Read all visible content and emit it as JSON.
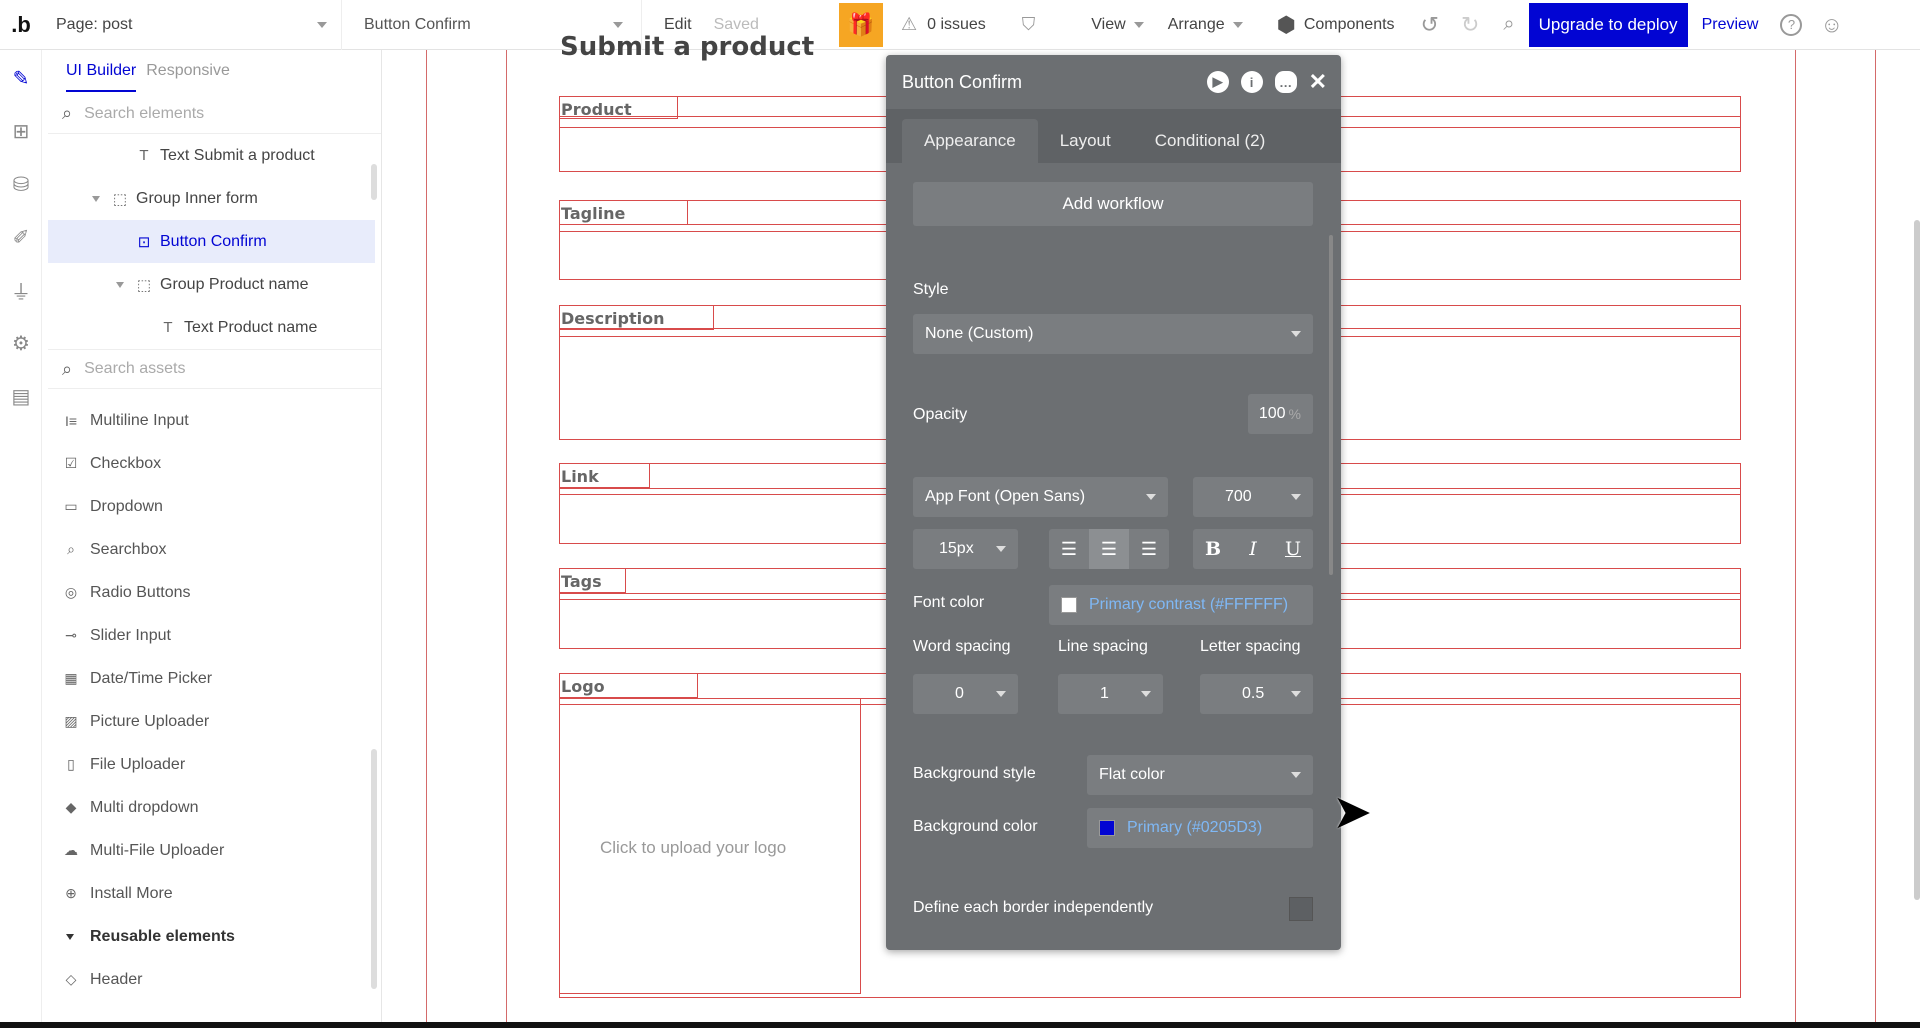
{
  "topbar": {
    "logo": ".b",
    "page_label": "Page: post",
    "element_label": "Button Confirm",
    "edit": "Edit",
    "saved": "Saved",
    "issues": "0 issues",
    "view": "View",
    "arrange": "Arrange",
    "components": "Components",
    "deploy": "Upgrade to deploy",
    "preview": "Preview",
    "help": "?"
  },
  "leftpanel": {
    "tab_ui": "UI Builder",
    "tab_responsive": "Responsive",
    "search_elements_placeholder": "Search elements",
    "tree": [
      {
        "label": "Text Submit a product"
      },
      {
        "label": "Group Inner form"
      },
      {
        "label": "Button Confirm"
      },
      {
        "label": "Group Product name"
      },
      {
        "label": "Text Product name"
      }
    ],
    "search_assets_placeholder": "Search assets",
    "assets": [
      {
        "label": "Multiline Input"
      },
      {
        "label": "Checkbox"
      },
      {
        "label": "Dropdown"
      },
      {
        "label": "Searchbox"
      },
      {
        "label": "Radio Buttons"
      },
      {
        "label": "Slider Input"
      },
      {
        "label": "Date/Time Picker"
      },
      {
        "label": "Picture Uploader"
      },
      {
        "label": "File Uploader"
      },
      {
        "label": "Multi dropdown"
      },
      {
        "label": "Multi-File Uploader"
      },
      {
        "label": "Install More"
      }
    ],
    "reusable_heading": "Reusable elements",
    "reusable_items": [
      {
        "label": "Header"
      }
    ]
  },
  "canvas": {
    "heading": "Submit a product",
    "fields": {
      "product": "Product",
      "tagline": "Tagline",
      "description": "Description",
      "link": "Link",
      "tags": "Tags",
      "logo": "Logo"
    },
    "upload_hint": "Click to upload your logo"
  },
  "editor": {
    "title": "Button Confirm",
    "tabs": {
      "appearance": "Appearance",
      "layout": "Layout",
      "conditional": "Conditional (2)"
    },
    "add_workflow": "Add workflow",
    "style_label": "Style",
    "style_value": "None (Custom)",
    "opacity_label": "Opacity",
    "opacity_value": "100",
    "opacity_unit": "%",
    "font_family": "App Font (Open Sans)",
    "font_weight": "700",
    "font_size": "15px",
    "font_color_label": "Font color",
    "font_color_value": "Primary contrast (#FFFFFF)",
    "font_color_hex": "#FFFFFF",
    "word_spacing_label": "Word spacing",
    "line_spacing_label": "Line spacing",
    "letter_spacing_label": "Letter spacing",
    "word_spacing": "0",
    "line_spacing": "1",
    "letter_spacing": "0.5",
    "bg_style_label": "Background style",
    "bg_style_value": "Flat color",
    "bg_color_label": "Background color",
    "bg_color_value": "Primary (#0205D3)",
    "bg_color_hex": "#0205D3",
    "border_label": "Define each border independently"
  },
  "colors": {
    "primary": "#0205D3",
    "gift": "#F6A623",
    "canvas_border": "#D84B4B",
    "editor_bg": "#6C6F72"
  }
}
